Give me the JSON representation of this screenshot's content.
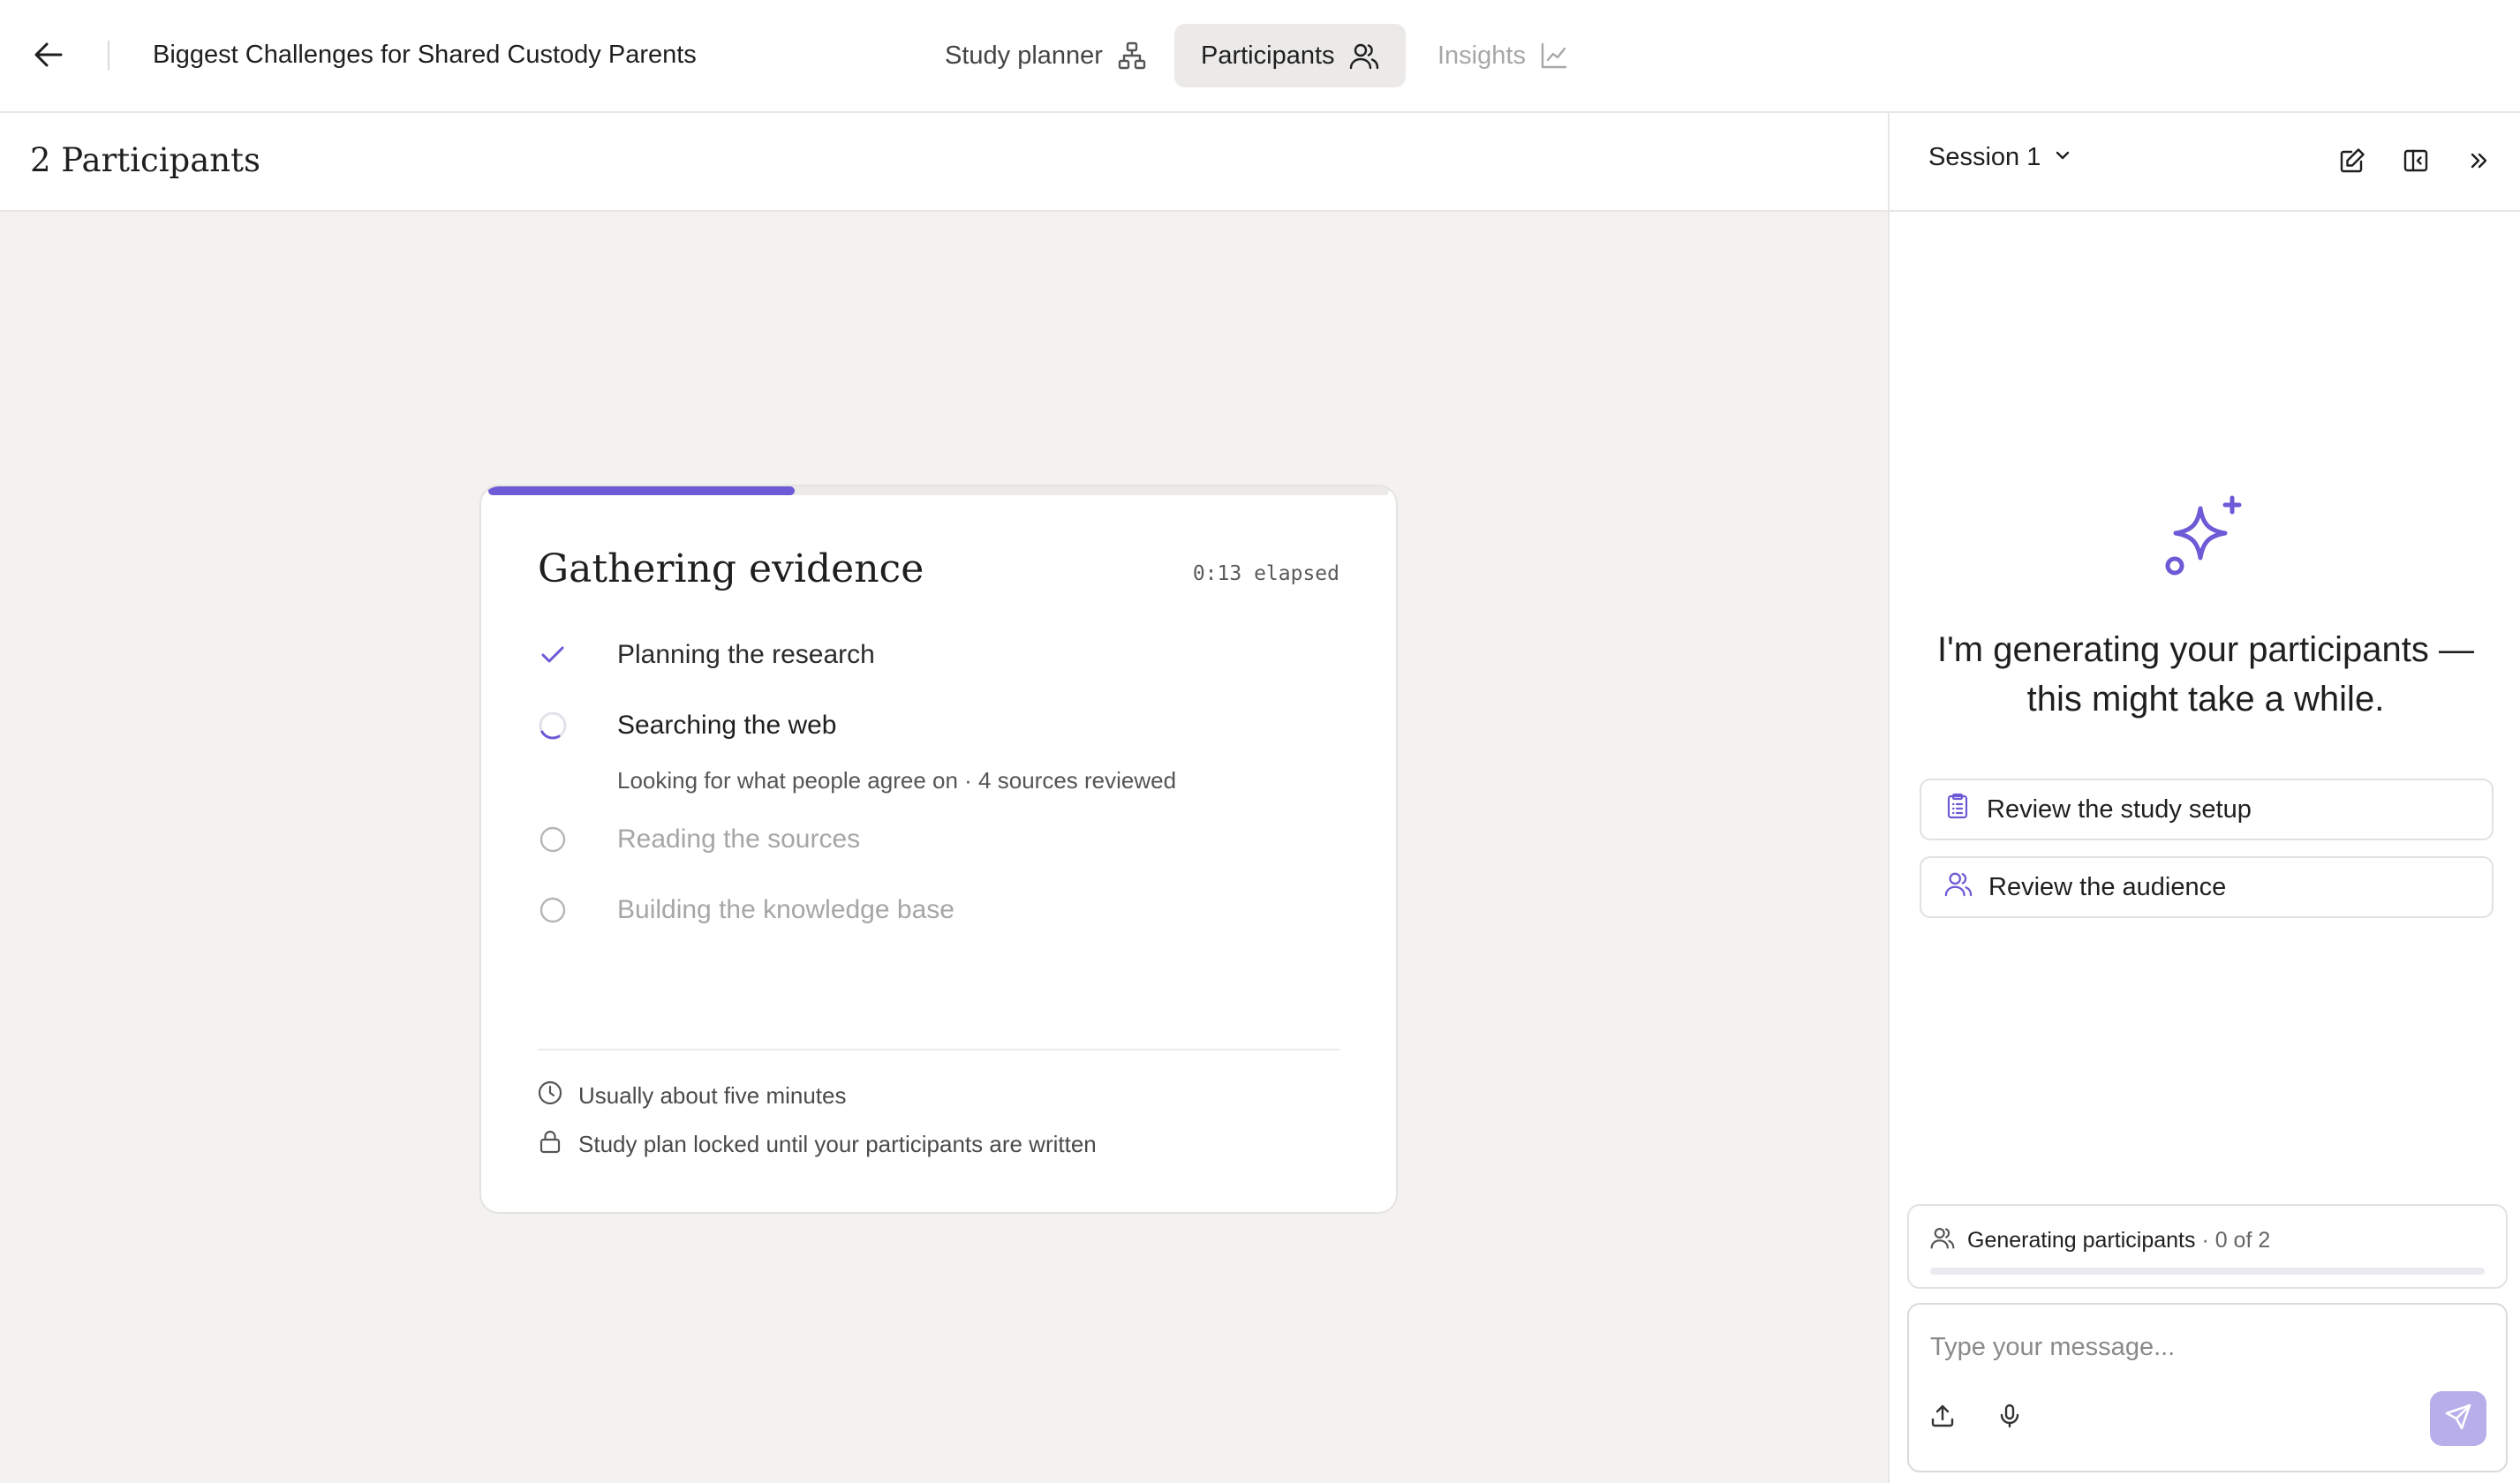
{
  "header": {
    "back_icon": "arrow-left-icon",
    "study_title": "Biggest Challenges for Shared Custody Parents",
    "tabs": [
      {
        "label": "Study planner",
        "icon": "sitemap-icon",
        "state": "default"
      },
      {
        "label": "Participants",
        "icon": "users-icon",
        "state": "selected"
      },
      {
        "label": "Insights",
        "icon": "line-chart-icon",
        "state": "disabled"
      }
    ]
  },
  "subheader": {
    "title": "2 Participants"
  },
  "progress_card": {
    "progress_fraction": 0.34,
    "title": "Gathering evidence",
    "elapsed": "0:13 elapsed",
    "steps": [
      {
        "label": "Planning the research",
        "status": "done"
      },
      {
        "label": "Searching the web",
        "status": "active",
        "detail": "Looking for what people agree on · 4 sources reviewed"
      },
      {
        "label": "Reading the sources",
        "status": "pending"
      },
      {
        "label": "Building the knowledge base",
        "status": "pending"
      }
    ],
    "notes": [
      {
        "icon": "clock-icon",
        "text": "Usually about five minutes"
      },
      {
        "icon": "lock-icon",
        "text": "Study plan locked until your participants are written"
      }
    ]
  },
  "panel": {
    "session_label": "Session 1",
    "header_actions": [
      "edit-icon",
      "panel-toggle-icon",
      "chevrons-right-icon"
    ],
    "generating_message": "I'm generating your participants — this might take a while.",
    "review_buttons": [
      {
        "label": "Review the study setup",
        "icon": "clipboard-list-icon"
      },
      {
        "label": "Review the audience",
        "icon": "users-icon"
      }
    ],
    "status": {
      "label": "Generating participants",
      "count": "· 0 of 2",
      "progress_fraction": 0.0
    },
    "composer": {
      "placeholder": "Type your message...",
      "value": ""
    }
  },
  "colors": {
    "accent": "#6c5ad6",
    "send_button": "#b7aeea",
    "canvas_bg": "#f3f2f0"
  }
}
